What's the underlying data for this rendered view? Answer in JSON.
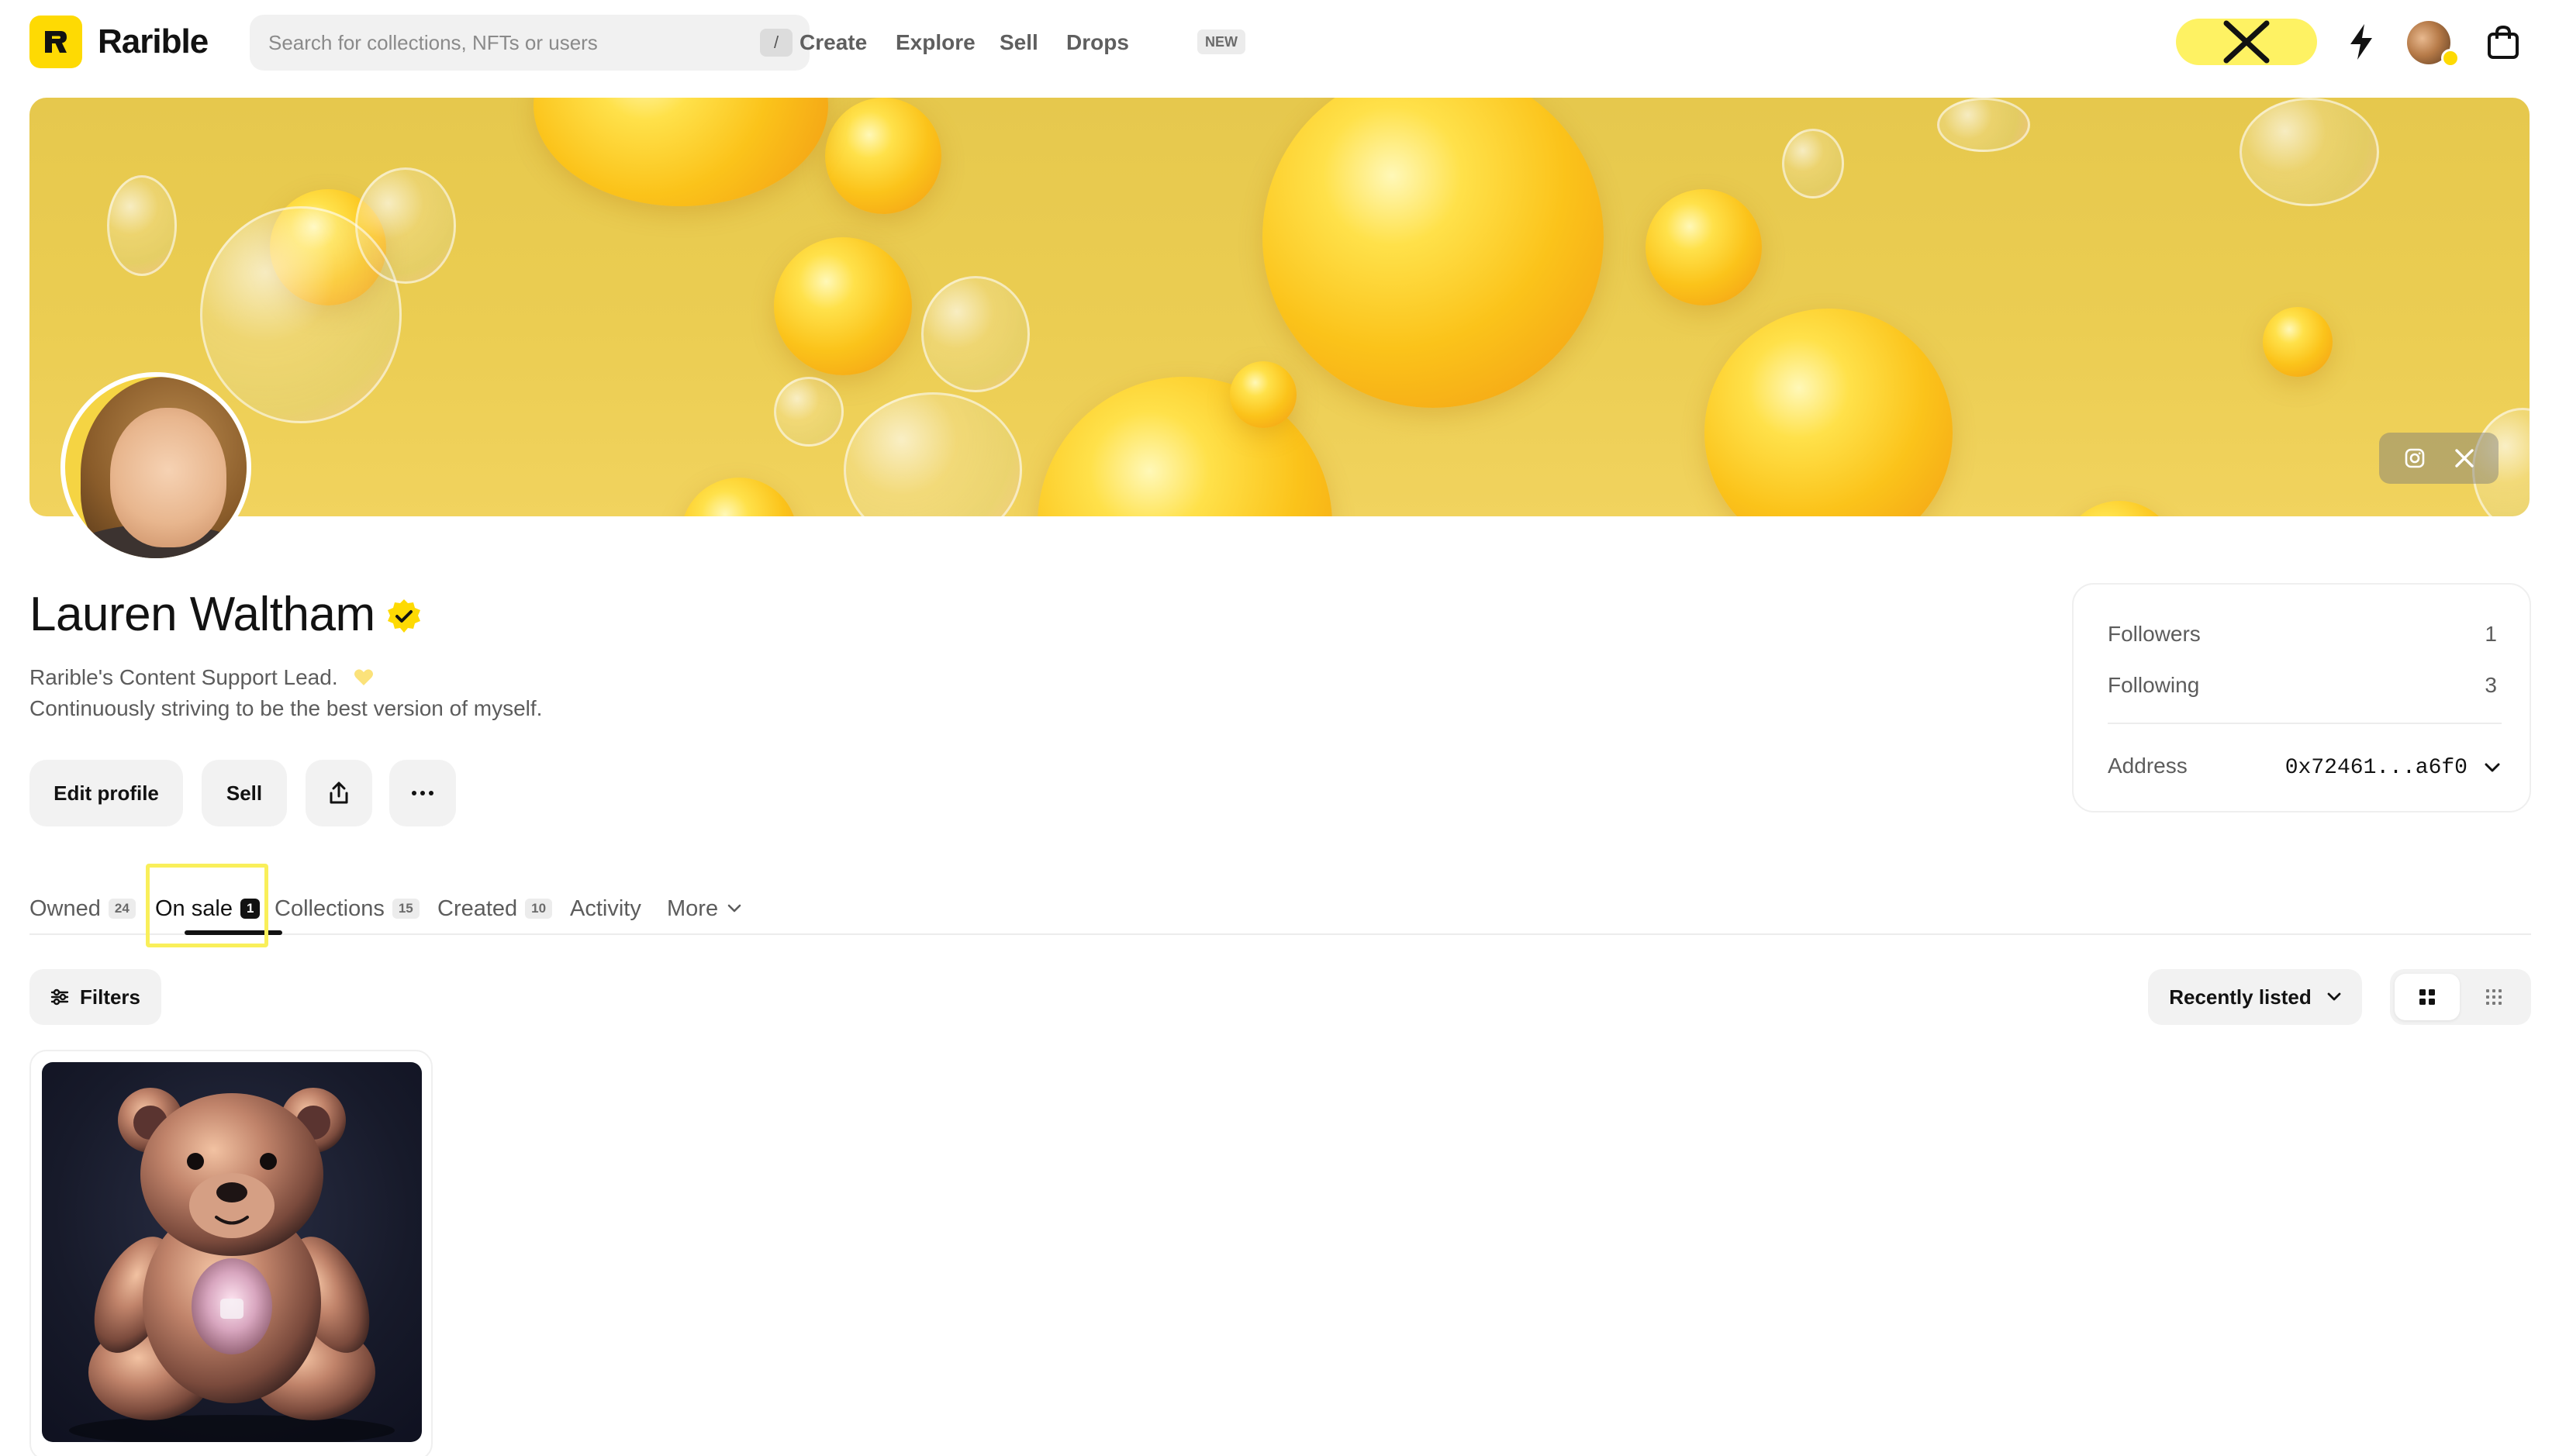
{
  "header": {
    "brand": "Rarible",
    "search_placeholder": "Search for collections, NFTs or users",
    "search_shortcut": "/",
    "nav": [
      {
        "label": "Create"
      },
      {
        "label": "Explore"
      },
      {
        "label": "Sell"
      },
      {
        "label": "Drops",
        "badge": "NEW"
      }
    ],
    "icons": {
      "x_pill": "x-logo-icon",
      "activity": "lightning-icon",
      "avatar": "user-avatar",
      "cart": "shopping-bag-icon"
    },
    "accent_color": "#FEDA03"
  },
  "banner": {
    "social": [
      "instagram-icon",
      "x-logo-icon"
    ]
  },
  "profile": {
    "name": "Lauren Waltham",
    "verified": true,
    "bio_line1": "Rarible's Content Support Lead.",
    "bio_line2": "Continuously striving to be the best version of myself.",
    "actions": {
      "edit": "Edit profile",
      "sell": "Sell",
      "share_icon": "share-icon",
      "more_icon": "ellipsis-icon"
    }
  },
  "stats": {
    "followers_label": "Followers",
    "followers_value": "1",
    "following_label": "Following",
    "following_value": "3",
    "address_label": "Address",
    "address_value": "0x72461...a6f0"
  },
  "tabs": [
    {
      "label": "Owned",
      "count": "24"
    },
    {
      "label": "On sale",
      "count": "1",
      "active": true
    },
    {
      "label": "Collections",
      "count": "15"
    },
    {
      "label": "Created",
      "count": "10"
    },
    {
      "label": "Activity"
    },
    {
      "label": "More"
    }
  ],
  "toolbar": {
    "filters": "Filters",
    "sort": "Recently listed",
    "view_modes": [
      "large-grid-icon",
      "small-grid-icon"
    ]
  }
}
